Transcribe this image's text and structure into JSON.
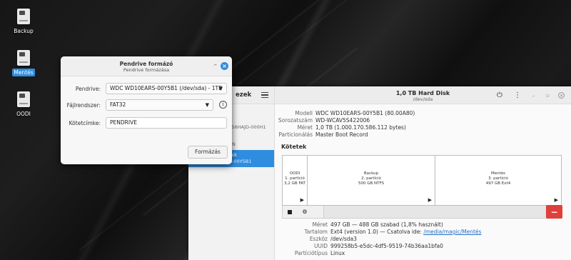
{
  "desktop": {
    "icons": [
      {
        "label": "Backup"
      },
      {
        "label": "Mentés"
      },
      {
        "label": "OODI"
      }
    ]
  },
  "disks": {
    "sidebar": {
      "title_fragment": "ezek",
      "items": [
        {
          "line1": "k",
          "line2": "2... S6HAJD-000H1"
        },
        {
          "line1": "ive",
          "line2": "UE1N"
        },
        {
          "line1": "t Disk",
          "line2": "ARS-00Y5B1"
        }
      ]
    },
    "header": {
      "title": "1,0 TB Hard Disk",
      "subtitle": "/dev/sda"
    },
    "info": [
      {
        "key": "Modell",
        "value": "WDC WD10EARS-00Y5B1 (80.00A80)"
      },
      {
        "key": "Sorozatszám",
        "value": "WD-WCAV5S422006"
      },
      {
        "key": "Méret",
        "value": "1,0 TB (1.000.170.586.112 bytes)"
      },
      {
        "key": "Particionálás",
        "value": "Master Boot Record"
      }
    ],
    "volumes_title": "Kötetek",
    "volumes": [
      {
        "name": "OODI",
        "part": "1. partíció",
        "size": "3,2 GB FAT"
      },
      {
        "name": "Backup",
        "part": "2. partíció",
        "size": "500 GB NTFS"
      },
      {
        "name": "Mentés",
        "part": "3. partíció",
        "size": "497 GB Ext4"
      }
    ],
    "details": [
      {
        "key": "Méret",
        "value": "497 GB — 488 GB szabad (1,8% használt)"
      },
      {
        "key": "Tartalom",
        "value": "Ext4 (version 1.0) — Csatolva ide: ",
        "link": "/media/magic/Mentés"
      },
      {
        "key": "Eszköz",
        "value": "/dev/sda3"
      },
      {
        "key": "UUID",
        "value": "999258b5-e5dc-4df5-9519-74b36aa1bfa0"
      },
      {
        "key": "Partíciótípus",
        "value": "Linux"
      }
    ]
  },
  "dialog": {
    "title": "Pendrive formázó",
    "subtitle": "Pendrive formázása",
    "pendrive_label": "Pendrive:",
    "pendrive_value": "WDC WD10EARS-00Y5B1 (/dev/sda) - 1TB",
    "fs_label": "Fájlrendszer:",
    "fs_value": "FAT32",
    "volume_label_label": "Kötetcímke:",
    "volume_label_value": "PENDRIVE",
    "format_button": "Formázás"
  },
  "colors": {
    "accent": "#2f8de0",
    "danger": "#e0403a"
  }
}
